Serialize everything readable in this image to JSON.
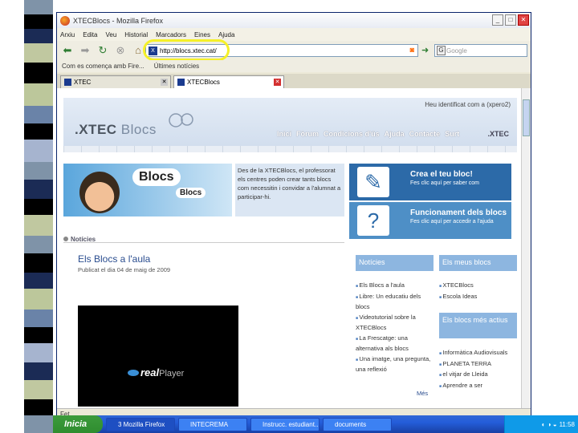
{
  "window": {
    "title": "XTECBlocs - Mozilla Firefox"
  },
  "menu": [
    "Arxiu",
    "Edita",
    "Veu",
    "Historial",
    "Marcadors",
    "Eines",
    "Ajuda"
  ],
  "address": {
    "url": "http://blocs.xtec.cat/",
    "search_engine_label": "G",
    "search_placeholder": "Google"
  },
  "bookmarks": [
    "Com es comença amb Fire...",
    "Últimes notícies"
  ],
  "tabs": [
    {
      "label": "XTEC"
    },
    {
      "label": "XTECBlocs"
    }
  ],
  "site": {
    "login_text": "Heu identificat com a (xpero2)",
    "logo_text": ".XTEC",
    "logo_text2": " Blocs",
    "nav": [
      "Inici",
      "Fòrum",
      "Condicions d'ús",
      "Ajuda",
      "Contacte",
      "Surt"
    ],
    "nav_logo": ".XTEC",
    "banner_big": "Blocs",
    "banner_small": "Blocs",
    "intro": "Des de la XTECBlocs, el professorat els centres poden crear tants blocs com necessitin i convidar a l'alumnat a participar-hi.",
    "cta1_title": "Crea el teu bloc!",
    "cta1_sub": "Fes clic aquí per saber com",
    "cta2_title": "Funcionament dels blocs",
    "cta2_sub": "Fes clic aquí per accedir a l'ajuda",
    "news_label": "Notícies",
    "post_title": "Els Blocs a l'aula",
    "post_date": "Publicat el dia 04 de maig de 2009",
    "video_brand": "real",
    "video_brand2": "Player",
    "col1_head": "Notícies",
    "col2_head": "Els meus blocs",
    "col3_head": "Els blocs més actius",
    "col1_items": [
      "Els Blocs a l'aula",
      "Libre: Un educatiu dels blocs",
      "Videotutorial sobre la XTECBlocs",
      "La Frescatge: una alternativa als blocs",
      "Una imatge, una pregunta, una reflexió"
    ],
    "col2_items": [
      "XTECBlocs",
      "Escola Ideas"
    ],
    "col3_items": [
      "Informàtica Audiovisuals",
      "PLANETA TERRA",
      "el vitjar de Lleida",
      "Aprendre a ser"
    ],
    "more": "Més"
  },
  "status": "Fet",
  "taskbar": {
    "start": "Inicia",
    "items": [
      "3 Mozilla Firefox",
      "INTECREMA",
      "Instrucc. estudiant...",
      "documents"
    ],
    "time": "11:58"
  }
}
